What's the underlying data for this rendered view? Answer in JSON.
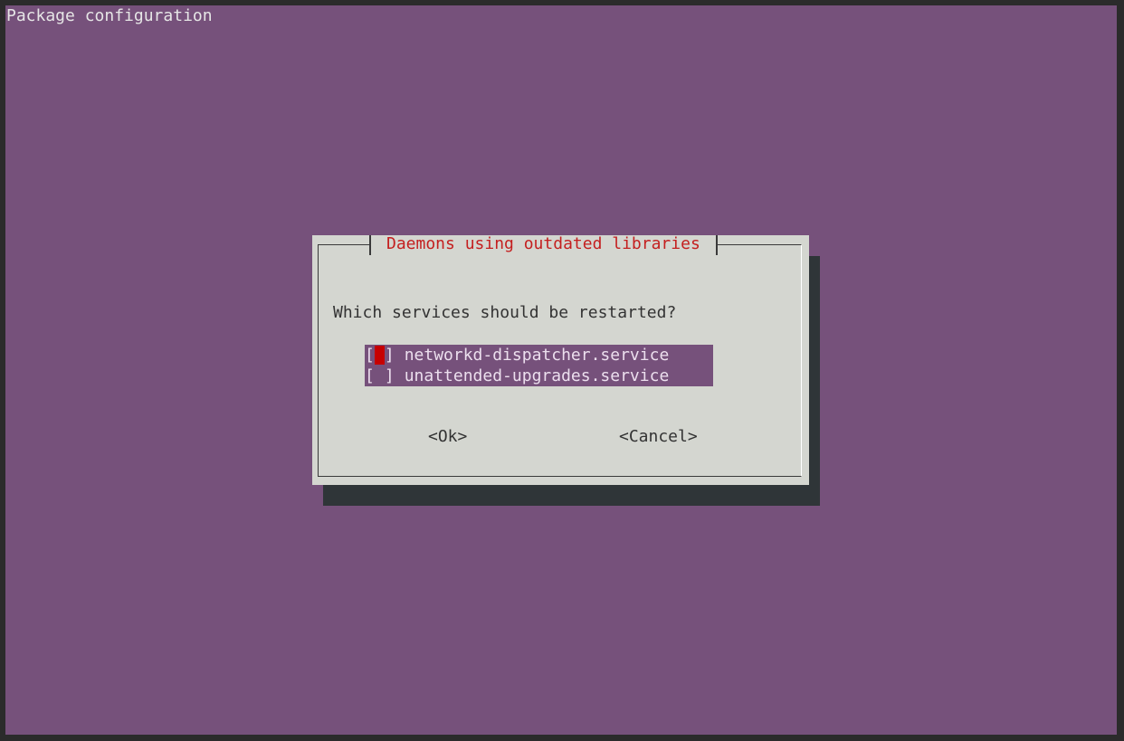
{
  "header": {
    "title": "Package configuration"
  },
  "dialog": {
    "title": "Daemons using outdated libraries",
    "question": "Which services should be restarted?",
    "items": [
      {
        "label": "networkd-dispatcher.service",
        "checked": false,
        "focused": true
      },
      {
        "label": "unattended-upgrades.service",
        "checked": false,
        "focused": false
      }
    ],
    "checkbox_open": "[",
    "checkbox_close": "]",
    "ok_label": "<Ok>",
    "cancel_label": "<Cancel>"
  },
  "colors": {
    "background": "#76517b",
    "dialog": "#d4d6d0",
    "shadow": "#2f3538",
    "title": "#c41f1f",
    "cursor": "#c60000"
  }
}
